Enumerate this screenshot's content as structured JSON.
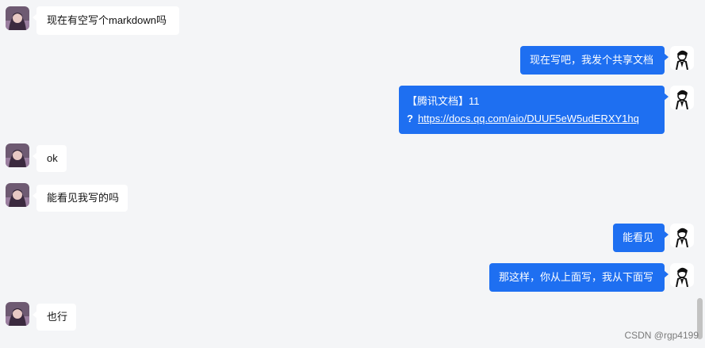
{
  "messages": [
    {
      "side": "left",
      "text": "现在有空写个markdown吗"
    },
    {
      "side": "right",
      "text": "现在写吧，我发个共享文档"
    },
    {
      "side": "right",
      "title": "【腾讯文档】11",
      "link_prefix": "?",
      "link": "https://docs.qq.com/aio/DUUF5eW5udERXY1hq"
    },
    {
      "side": "left",
      "text": "ok"
    },
    {
      "side": "left",
      "text": "能看见我写的吗"
    },
    {
      "side": "right",
      "text": "能看见"
    },
    {
      "side": "right",
      "text": "那这样，你从上面写，我从下面写"
    },
    {
      "side": "left",
      "text": "也行"
    }
  ],
  "avatars": {
    "left": "anime-girl-avatar",
    "right": "sketch-boy-avatar"
  },
  "watermark": "CSDN @rgp4199",
  "colors": {
    "bubble_self": "#1e6ff1",
    "bubble_other": "#ffffff",
    "background": "#f4f5f7"
  }
}
